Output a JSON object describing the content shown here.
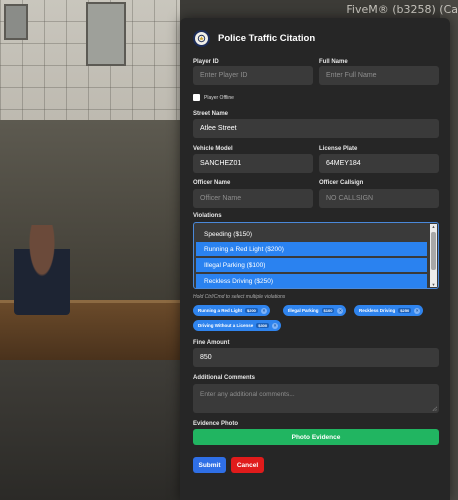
{
  "window": {
    "watermark": "FiveM® (b3258) (Ca"
  },
  "form": {
    "title": "Police Traffic Citation",
    "player_id": {
      "label": "Player ID",
      "placeholder": "Enter Player ID",
      "value": ""
    },
    "full_name": {
      "label": "Full Name",
      "placeholder": "Enter Full Name",
      "value": ""
    },
    "player_offline": {
      "label": "Player Offline",
      "checked": false
    },
    "street_name": {
      "label": "Street Name",
      "value": "Atlee Street"
    },
    "vehicle_model": {
      "label": "Vehicle Model",
      "value": "SANCHEZ01"
    },
    "license_plate": {
      "label": "License Plate",
      "value": "64MEY184"
    },
    "officer_name": {
      "label": "Officer Name",
      "placeholder": "Officer Name",
      "value": ""
    },
    "officer_callsign": {
      "label": "Officer Callsign",
      "placeholder": "NO CALLSIGN",
      "value": ""
    },
    "violations": {
      "label": "Violations",
      "options": [
        {
          "label": "Speeding ($150)",
          "selected": false
        },
        {
          "label": "Running a Red Light ($200)",
          "selected": true
        },
        {
          "label": "Illegal Parking ($100)",
          "selected": true
        },
        {
          "label": "Reckless Driving ($250)",
          "selected": true
        }
      ],
      "hint": "Hold Ctrl/Cmd to select multiple violations"
    },
    "selected_chips": [
      {
        "label": "Running a Red Light",
        "price": "$200",
        "remove": "×"
      },
      {
        "label": "Illegal Parking",
        "price": "$100",
        "remove": "×"
      },
      {
        "label": "Reckless Driving",
        "price": "$250",
        "remove": "×"
      },
      {
        "label": "Driving Without a License",
        "price": "$300",
        "remove": "×"
      }
    ],
    "fine_amount": {
      "label": "Fine Amount",
      "value": "850"
    },
    "additional_comments": {
      "label": "Additional Comments",
      "placeholder": "Enter any additional comments..."
    },
    "evidence_photo": {
      "label": "Evidence Photo",
      "button": "Photo Evidence"
    },
    "submit_label": "Submit",
    "cancel_label": "Cancel"
  },
  "colors": {
    "panel_bg": "#262626",
    "field_bg": "#3a3a3a",
    "accent_blue": "#2a82f0",
    "evidence_green": "#21b561",
    "cancel_red": "#e01b1b"
  }
}
